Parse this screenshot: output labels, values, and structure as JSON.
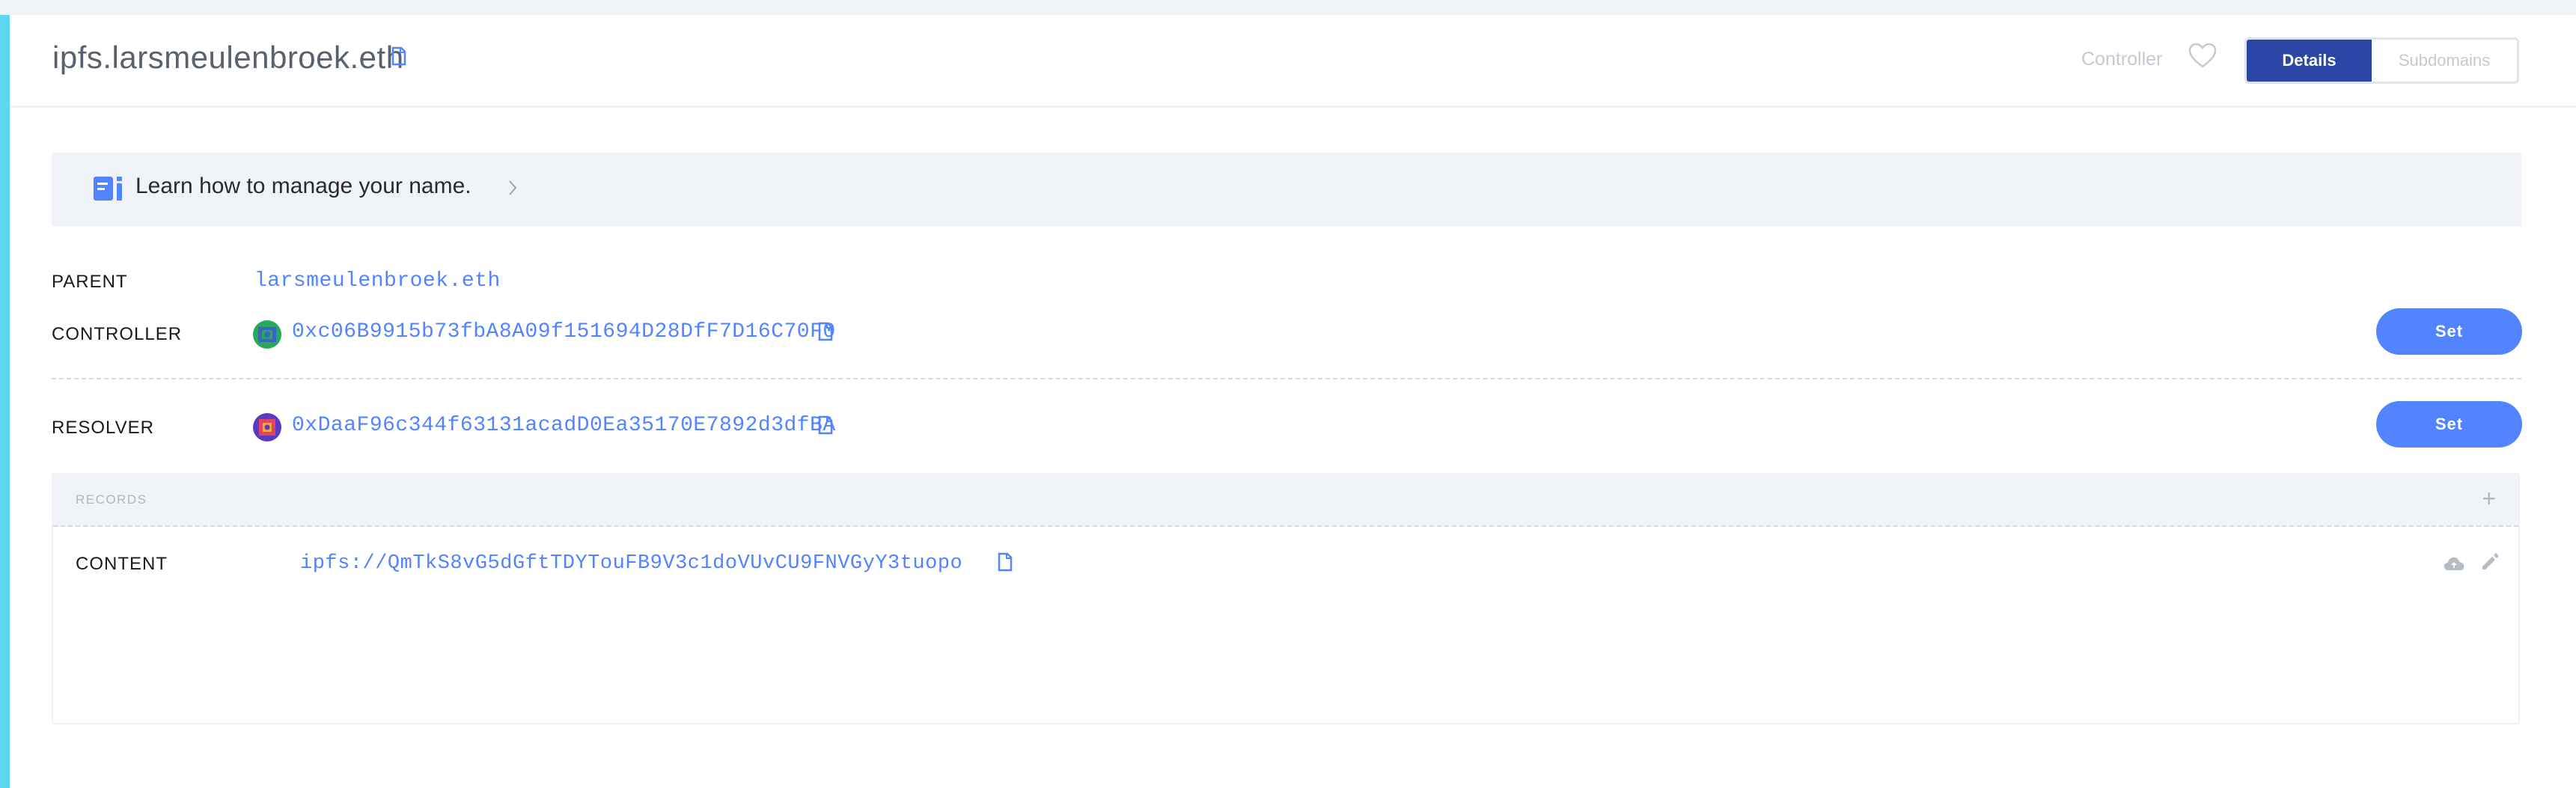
{
  "header": {
    "domain": "ipfs.larsmeulenbroek.eth",
    "controller_label": "Controller",
    "tabs": [
      {
        "label": "Details",
        "active": true
      },
      {
        "label": "Subdomains",
        "active": false
      }
    ]
  },
  "learn": {
    "text": "Learn how to manage your name."
  },
  "details": {
    "parent": {
      "label": "PARENT",
      "value": "larsmeulenbroek.eth"
    },
    "controller": {
      "label": "CONTROLLER",
      "value": "0xc06B9915b73fbA8A09f151694D28DfF7D16C70F0",
      "button": "Set"
    },
    "resolver": {
      "label": "RESOLVER",
      "value": "0xDaaF96c344f63131acadD0Ea35170E7892d3dfBA",
      "button": "Set"
    }
  },
  "records": {
    "title": "RECORDS",
    "add_symbol": "+",
    "content": {
      "label": "CONTENT",
      "value": "ipfs://QmTkS8vG5dGftTDYTouFB9V3c1doVUvCU9FNVGyY3tuopo"
    }
  },
  "colors": {
    "accent": "#5284ff",
    "tab_active": "#2c46a6",
    "side_bar": "#5bd7f0"
  }
}
